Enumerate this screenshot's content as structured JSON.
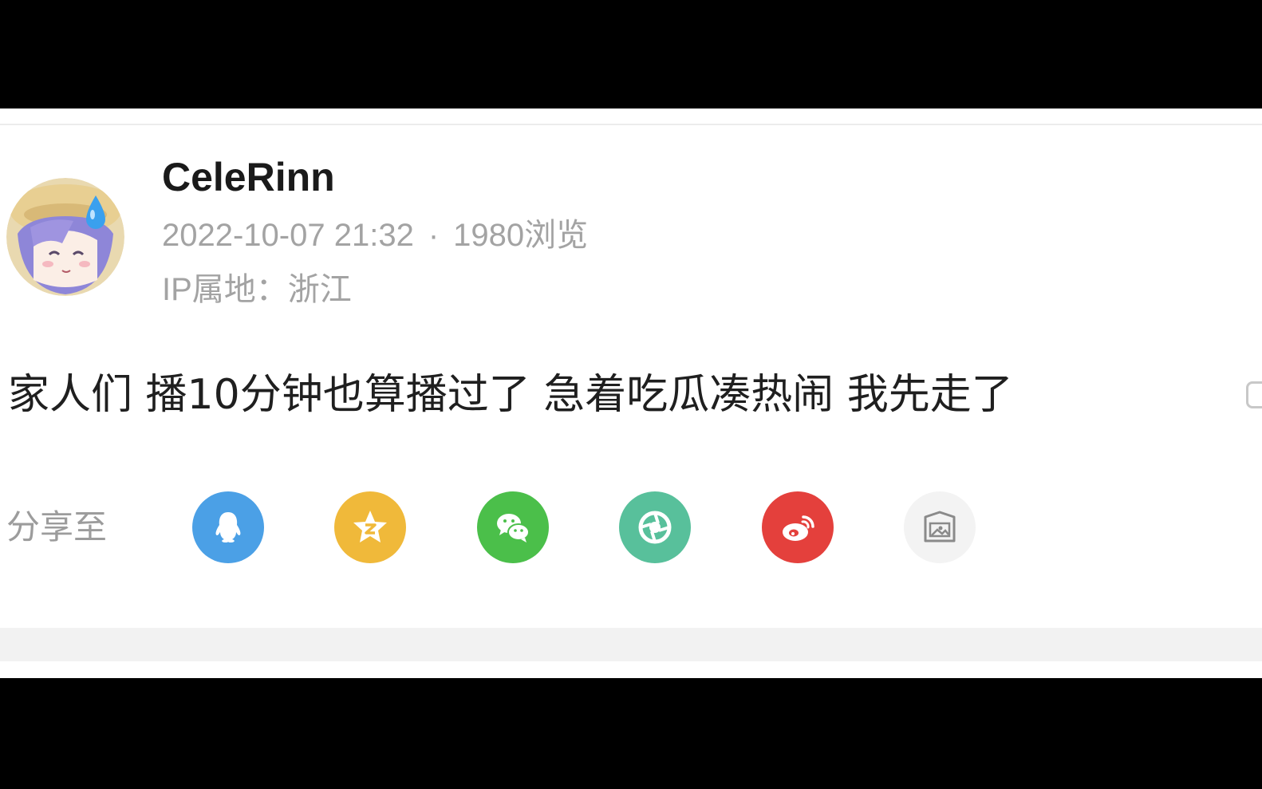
{
  "post": {
    "username": "CeleRinn",
    "datetime": "2022-10-07 21:32",
    "separator": "·",
    "views": "1980浏览",
    "ip_location": "IP属地：浙江",
    "content": "家人们 播10分钟也算播过了 急着吃瓜凑热闹 我先走了"
  },
  "share": {
    "label": "分享至",
    "targets": [
      {
        "icon": "qq-icon",
        "color": "#4ba0e6"
      },
      {
        "icon": "qzone-icon",
        "color": "#f0b93a"
      },
      {
        "icon": "wechat-icon",
        "color": "#4bbf4a"
      },
      {
        "icon": "moments-icon",
        "color": "#58c09b"
      },
      {
        "icon": "weibo-icon",
        "color": "#e4403c"
      },
      {
        "icon": "image-share-icon",
        "color": "#f3f3f3"
      }
    ]
  }
}
